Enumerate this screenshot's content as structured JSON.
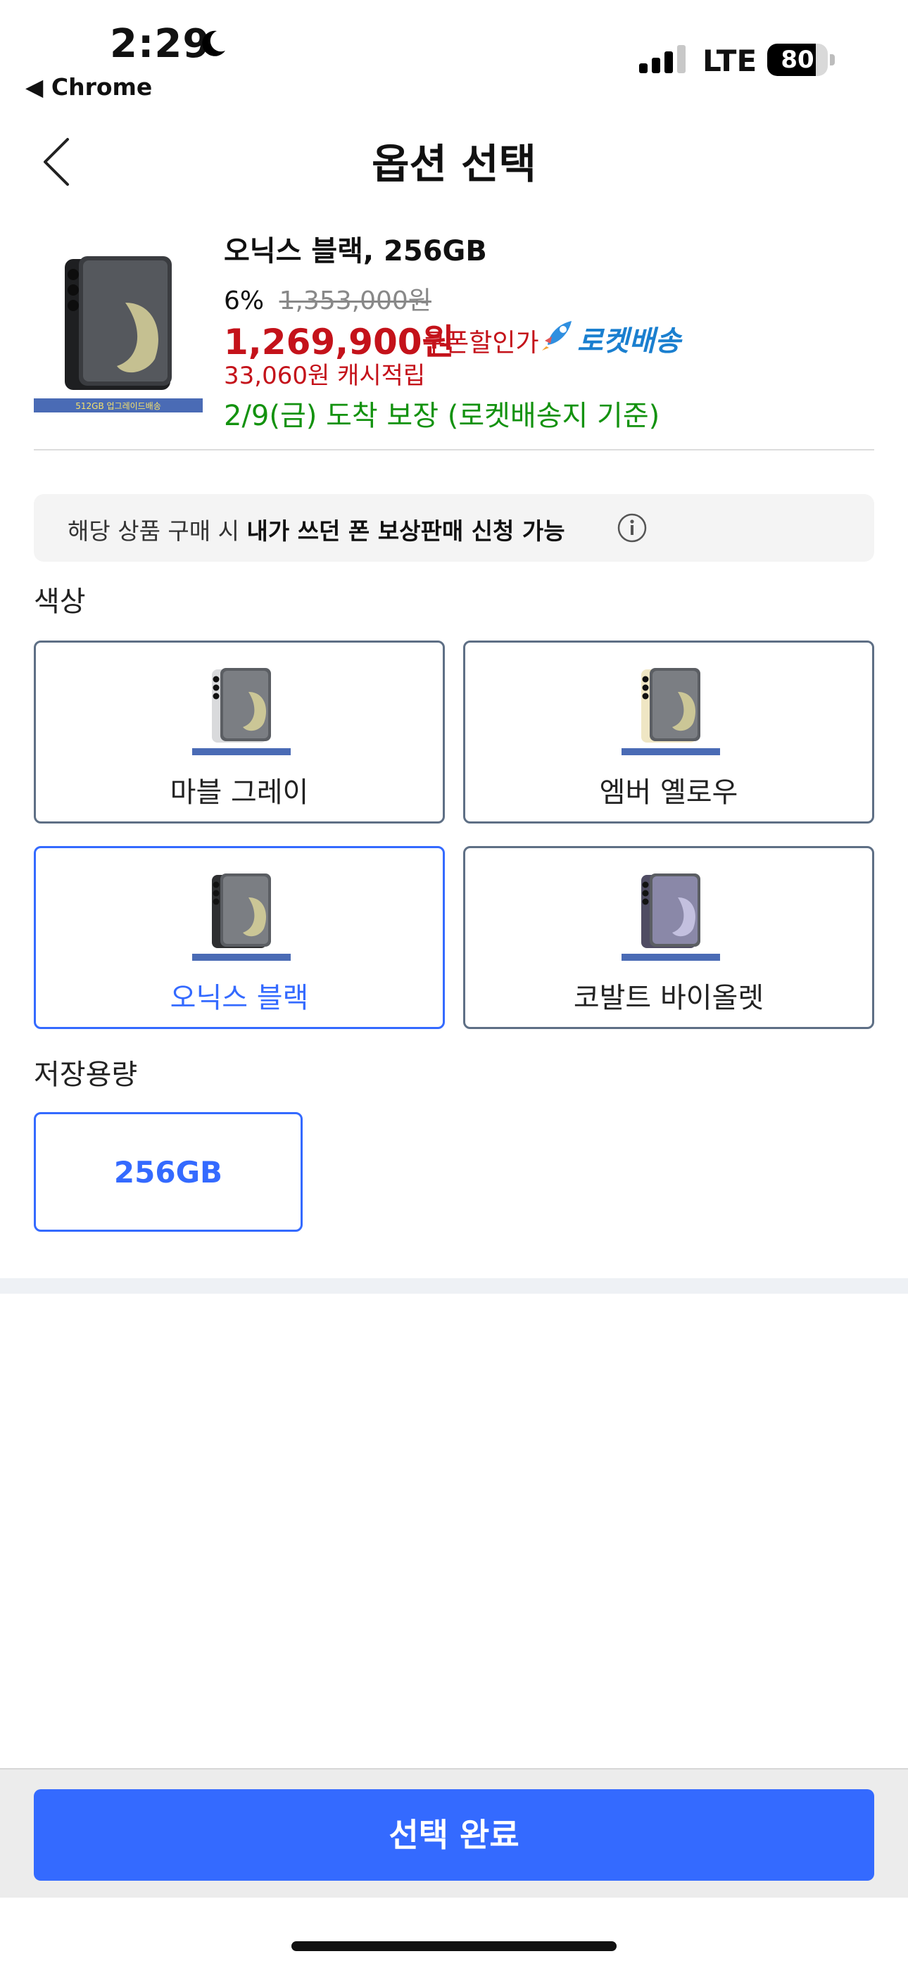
{
  "status_bar": {
    "time": "2:29",
    "back_app": "◀ Chrome",
    "network": "LTE",
    "battery": "80",
    "battery_level": 0.8
  },
  "header": {
    "title": "옵션 선택"
  },
  "product": {
    "name": "오닉스 블랙, 256GB",
    "discount": "6%",
    "original_price": "1,353,000원",
    "sale_price": "1,269,900원",
    "coupon_label": "쿠폰할인가",
    "rocket_label": "로켓배송",
    "cashback": "33,060원 캐시적립",
    "delivery": "2/9(금) 도착 보장 (로켓배송지 기준)",
    "image_banner": "512GB 업그레이드배송"
  },
  "notice": {
    "text_prefix": "해당 상품 구매 시 ",
    "text_bold": "내가 쓰던 폰 보상판매 신청 가능"
  },
  "color_section": {
    "label": "색상",
    "options": [
      {
        "label": "마블 그레이",
        "selected": false,
        "color": "#d9dadc"
      },
      {
        "label": "엠버 옐로우",
        "selected": false,
        "color": "#efe6c4"
      },
      {
        "label": "오닉스 블랙",
        "selected": true,
        "color": "#2e2f31"
      },
      {
        "label": "코발트 바이올렛",
        "selected": false,
        "color": "#4f4c63"
      }
    ]
  },
  "storage_section": {
    "label": "저장용량",
    "options": [
      {
        "label": "256GB",
        "selected": true
      }
    ]
  },
  "footer": {
    "confirm_label": "선택 완료"
  },
  "colors": {
    "accent": "#346aff",
    "sale_red": "#c4121a",
    "delivery_green": "#13920f",
    "rocket_blue": "#1a7fcf"
  }
}
